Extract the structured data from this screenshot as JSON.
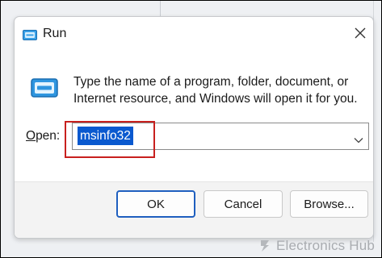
{
  "dialog": {
    "title": "Run",
    "message": "Type the name of a program, folder, document, or Internet resource, and Windows will open it for you.",
    "open_label_prefix": "",
    "open_label_accel": "O",
    "open_label_rest": "pen:",
    "input_value": "msinfo32",
    "buttons": {
      "ok": "OK",
      "cancel": "Cancel",
      "browse": "Browse..."
    }
  },
  "watermark": {
    "text": "Electronics Hub"
  },
  "icons": {
    "title": "run-icon",
    "main": "run-icon",
    "close": "close-icon",
    "dropdown": "chevron-down-icon",
    "watermark": "electronics-hub-logo-icon"
  },
  "colors": {
    "selection": "#0a59cf",
    "highlight_box": "#c8201e",
    "ok_border": "#1f5fbf"
  }
}
